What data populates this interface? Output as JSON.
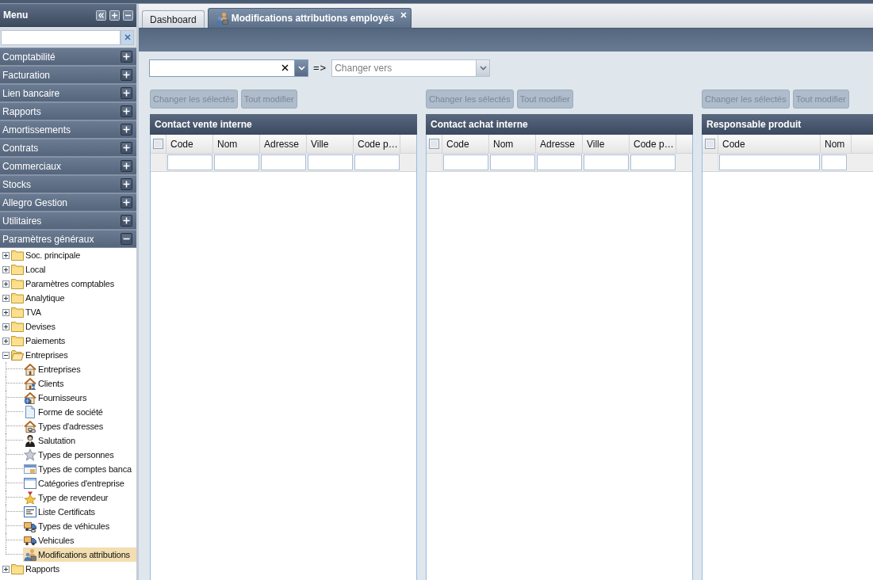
{
  "sidebar": {
    "title": "Menu",
    "sections": [
      {
        "label": "Comptabilité",
        "expanded": false
      },
      {
        "label": "Facturation",
        "expanded": false
      },
      {
        "label": "Lien bancaire",
        "expanded": false
      },
      {
        "label": "Rapports",
        "expanded": false
      },
      {
        "label": "Amortissements",
        "expanded": false
      },
      {
        "label": "Contrats",
        "expanded": false
      },
      {
        "label": "Commerciaux",
        "expanded": false
      },
      {
        "label": "Stocks",
        "expanded": false
      },
      {
        "label": "Allegro Gestion",
        "expanded": false
      },
      {
        "label": "Utilitaires",
        "expanded": false
      },
      {
        "label": "Paramètres généraux",
        "expanded": true
      }
    ],
    "tree": [
      {
        "label": "Soc. principale",
        "expanded": false,
        "selected": false
      },
      {
        "label": "Local",
        "expanded": false,
        "selected": false
      },
      {
        "label": "Paramètres comptables",
        "expanded": false,
        "selected": false
      },
      {
        "label": "Analytique",
        "expanded": false,
        "selected": false
      },
      {
        "label": "TVA",
        "expanded": false,
        "selected": false
      },
      {
        "label": "Devises",
        "expanded": false,
        "selected": false
      },
      {
        "label": "Paiements",
        "expanded": false,
        "selected": false
      },
      {
        "label": "Entreprises",
        "expanded": true,
        "selected": false,
        "children": [
          {
            "label": "Entreprises",
            "kind": "house",
            "selected": false
          },
          {
            "label": "Clients",
            "kind": "house-person",
            "selected": false
          },
          {
            "label": "Fournisseurs",
            "kind": "house-globe",
            "selected": false
          },
          {
            "label": "Forme de société",
            "kind": "document",
            "selected": false
          },
          {
            "label": "Types d'adresses",
            "kind": "house-link",
            "selected": false
          },
          {
            "label": "Salutation",
            "kind": "person",
            "selected": false
          },
          {
            "label": "Types de personnes",
            "kind": "star",
            "selected": false
          },
          {
            "label": "Types de comptes banca",
            "kind": "card",
            "selected": false
          },
          {
            "label": "Catégories d'entreprise",
            "kind": "window",
            "selected": false
          },
          {
            "label": "Type de revendeur",
            "kind": "medal",
            "selected": false
          },
          {
            "label": "Liste Certificats",
            "kind": "list",
            "selected": false
          },
          {
            "label": "Types de véhicules",
            "kind": "truck-link",
            "selected": false
          },
          {
            "label": "Vehicules",
            "kind": "truck",
            "selected": false
          },
          {
            "label": "Modifications attributions",
            "kind": "people",
            "selected": true
          }
        ]
      },
      {
        "label": "Rapports",
        "expanded": false,
        "selected": false
      }
    ]
  },
  "tabs": [
    {
      "label": "Dashboard",
      "kind": "plain",
      "selected": false,
      "closable": false
    },
    {
      "label": "Modifications attributions employés",
      "kind": "people",
      "selected": true,
      "closable": true
    }
  ],
  "filter": {
    "source": {
      "focused": true
    },
    "separator": "=>",
    "target": {
      "placeholder": "Changer vers",
      "focused": false
    }
  },
  "panels": [
    {
      "title": "Contact vente interne",
      "buttons": [
        {
          "label": "Changer les sélectés",
          "disabled": true
        },
        {
          "label": "Tout modifier",
          "disabled": true
        }
      ],
      "select_all": false,
      "columns": [
        "Code",
        "Nom",
        "Adresse",
        "Ville",
        "Code p…"
      ]
    },
    {
      "title": "Contact achat interne",
      "buttons": [
        {
          "label": "Changer les sélectés",
          "disabled": true
        },
        {
          "label": "Tout modifier",
          "disabled": true
        }
      ],
      "select_all": false,
      "columns": [
        "Code",
        "Nom",
        "Adresse",
        "Ville",
        "Code p…"
      ]
    },
    {
      "title": "Responsable produit",
      "buttons": [
        {
          "label": "Changer les sélectés",
          "disabled": true
        },
        {
          "label": "Tout modifier",
          "disabled": true
        }
      ],
      "select_all": false,
      "columns": [
        "Code",
        "Nom"
      ]
    }
  ]
}
